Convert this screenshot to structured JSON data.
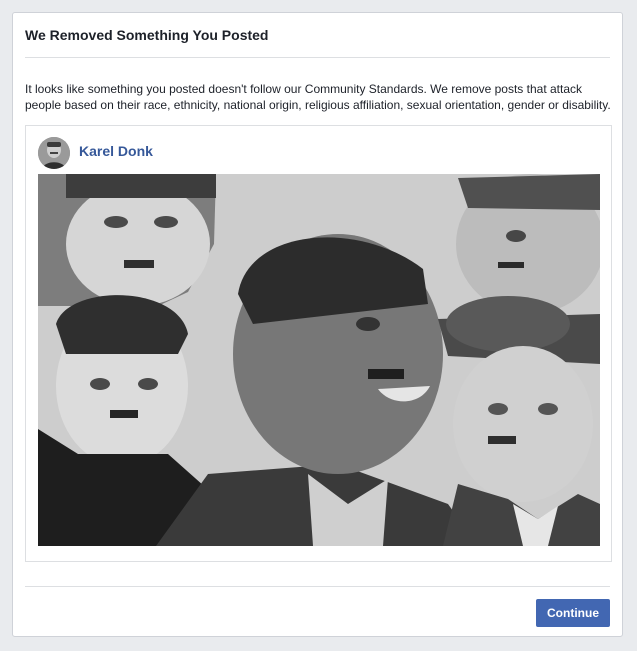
{
  "dialog": {
    "title": "We Removed Something You Posted",
    "message": "It looks like something you posted doesn't follow our Community Standards. We remove posts that attack people based on their race, ethnicity, national origin, religious affiliation, sexual orientation, gender or disability.",
    "continue_label": "Continue"
  },
  "post": {
    "author": "Karel Donk",
    "avatar_icon": "user-avatar-icon",
    "image_icon": "photo-collage-icon"
  },
  "colors": {
    "accent": "#4267b2",
    "author_link": "#365899",
    "page_background": "#e9ebee",
    "image_background": "#cdcdcd"
  }
}
